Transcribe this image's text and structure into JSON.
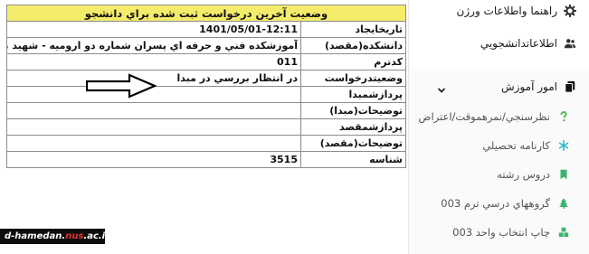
{
  "table": {
    "title": "وضعيت آخرين درخواست ثبت شده براي دانشجو",
    "rows": [
      {
        "label": "تاريخايجاد",
        "value": "1401/05/01-12:11"
      },
      {
        "label": "دانشكده(مقصد)",
        "value": "آموزشكده فني و حرفه اي پسران شماره دو اروميه - شهيد بهشتي"
      },
      {
        "label": "كدترم",
        "value": "011"
      },
      {
        "label": "وضعيتدرخواست",
        "value": "در انتظار بررسي در مبدا"
      },
      {
        "label": "پردازشمبدا",
        "value": ""
      },
      {
        "label": "توضيحات(مبدا)",
        "value": ""
      },
      {
        "label": "پردازشمقصد",
        "value": ""
      },
      {
        "label": "توضيحات(مقصد)",
        "value": ""
      },
      {
        "label": "شناسه",
        "value": "3515"
      }
    ]
  },
  "watermark": {
    "part1": "d-hamedan.",
    "part2": "nus",
    "part3": ".ac.ir"
  },
  "sidebar": {
    "items": [
      {
        "label": "راهنما واطلاعات ورژن",
        "icon": "gear-icon"
      },
      {
        "label": "اطلاعاتدانشجويي",
        "icon": "users-icon"
      },
      {
        "label": "امور آموزش",
        "icon": "copy-icon",
        "expanded": true
      }
    ],
    "sub_items": [
      {
        "label": "نظرسنجي/نمرهموقت/اعتراض",
        "icon": "question-icon",
        "color": "#5cb85c"
      },
      {
        "label": "كارنامه تحصيلي",
        "icon": "snowflake-icon",
        "color": "#27b8c9"
      },
      {
        "label": "دروس رشته",
        "icon": "bookmark-icon",
        "color": "#3cb371"
      },
      {
        "label": "گروههاي درسي ترم 003",
        "icon": "tree-icon",
        "color": "#3cb371"
      },
      {
        "label": "چاپ انتخاب واحد 003",
        "icon": "cubes-icon",
        "color": "#3cb371"
      }
    ]
  },
  "colors": {
    "title_bg": "#f4ec6a",
    "watermark_bg": "#0d0d0d",
    "watermark_accent": "#e3342f"
  }
}
